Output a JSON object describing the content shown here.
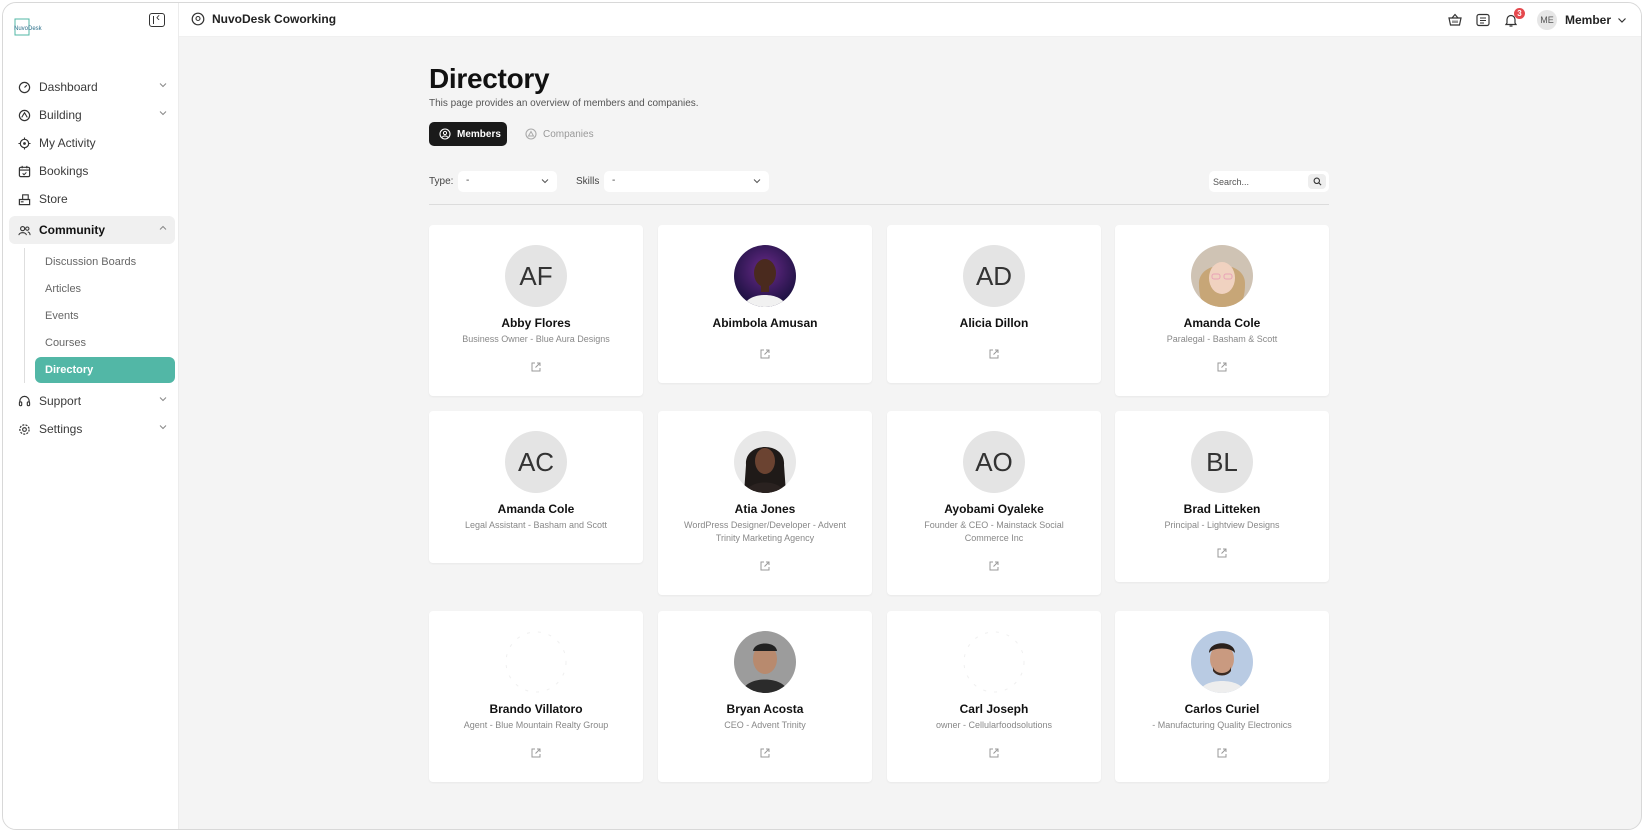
{
  "app": {
    "logo_text": "NuvoDesk",
    "org_name": "NuvoDesk Coworking",
    "notification_count": "3",
    "user_initials": "ME",
    "user_role": "Member"
  },
  "sidebar": {
    "items": [
      {
        "label": "Dashboard",
        "icon": "gauge-icon",
        "has_chevron": true
      },
      {
        "label": "Building",
        "icon": "building-icon",
        "has_chevron": true
      },
      {
        "label": "My Activity",
        "icon": "target-icon",
        "has_chevron": false
      },
      {
        "label": "Bookings",
        "icon": "calendar-icon",
        "has_chevron": false
      },
      {
        "label": "Store",
        "icon": "store-icon",
        "has_chevron": false
      },
      {
        "label": "Community",
        "icon": "users-icon",
        "has_chevron": true,
        "expanded": true
      }
    ],
    "community_sub": [
      "Discussion Boards",
      "Articles",
      "Events",
      "Courses",
      "Directory"
    ],
    "bottom_items": [
      {
        "label": "Support",
        "icon": "headset-icon"
      },
      {
        "label": "Settings",
        "icon": "gear-icon"
      }
    ],
    "accent": "#52b7a6"
  },
  "page": {
    "title": "Directory",
    "description": "This page provides an overview of members and companies.",
    "tabs": {
      "members": "Members",
      "companies": "Companies"
    },
    "filters": {
      "type_label": "Type:",
      "type_value": "-",
      "skills_label": "Skills",
      "skills_value": "-",
      "search_placeholder": "Search..."
    }
  },
  "members": [
    {
      "name": "Abby Flores",
      "subtitle": "Business Owner - Blue Aura Designs",
      "initials": "AF",
      "avatar": "initials"
    },
    {
      "name": "Abimbola Amusan",
      "subtitle": "",
      "initials": "",
      "avatar": "photo-dark-purple"
    },
    {
      "name": "Alicia Dillon",
      "subtitle": "",
      "initials": "AD",
      "avatar": "initials"
    },
    {
      "name": "Amanda Cole",
      "subtitle": "Paralegal - Basham & Scott",
      "initials": "",
      "avatar": "photo-blonde"
    },
    {
      "name": "Amanda Cole",
      "subtitle": "Legal Assistant - Basham and Scott",
      "initials": "AC",
      "avatar": "initials"
    },
    {
      "name": "Atia Jones",
      "subtitle": "WordPress Designer/Developer - Advent Trinity Marketing Agency",
      "initials": "",
      "avatar": "photo-dark-hair"
    },
    {
      "name": "Ayobami Oyaleke",
      "subtitle": "Founder & CEO - Mainstack Social Commerce Inc",
      "initials": "AO",
      "avatar": "initials"
    },
    {
      "name": "Brad Litteken",
      "subtitle": "Principal - Lightview Designs",
      "initials": "BL",
      "avatar": "initials"
    },
    {
      "name": "Brando Villatoro",
      "subtitle": "Agent - Blue Mountain Realty Group",
      "initials": "",
      "avatar": "broken"
    },
    {
      "name": "Bryan Acosta",
      "subtitle": "CEO - Advent Trinity",
      "initials": "",
      "avatar": "photo-grey"
    },
    {
      "name": "Carl Joseph",
      "subtitle": "owner - Cellularfoodsolutions",
      "initials": "",
      "avatar": "broken"
    },
    {
      "name": "Carlos Curiel",
      "subtitle": "- Manufacturing Quality Electronics",
      "initials": "",
      "avatar": "photo-blue"
    }
  ]
}
